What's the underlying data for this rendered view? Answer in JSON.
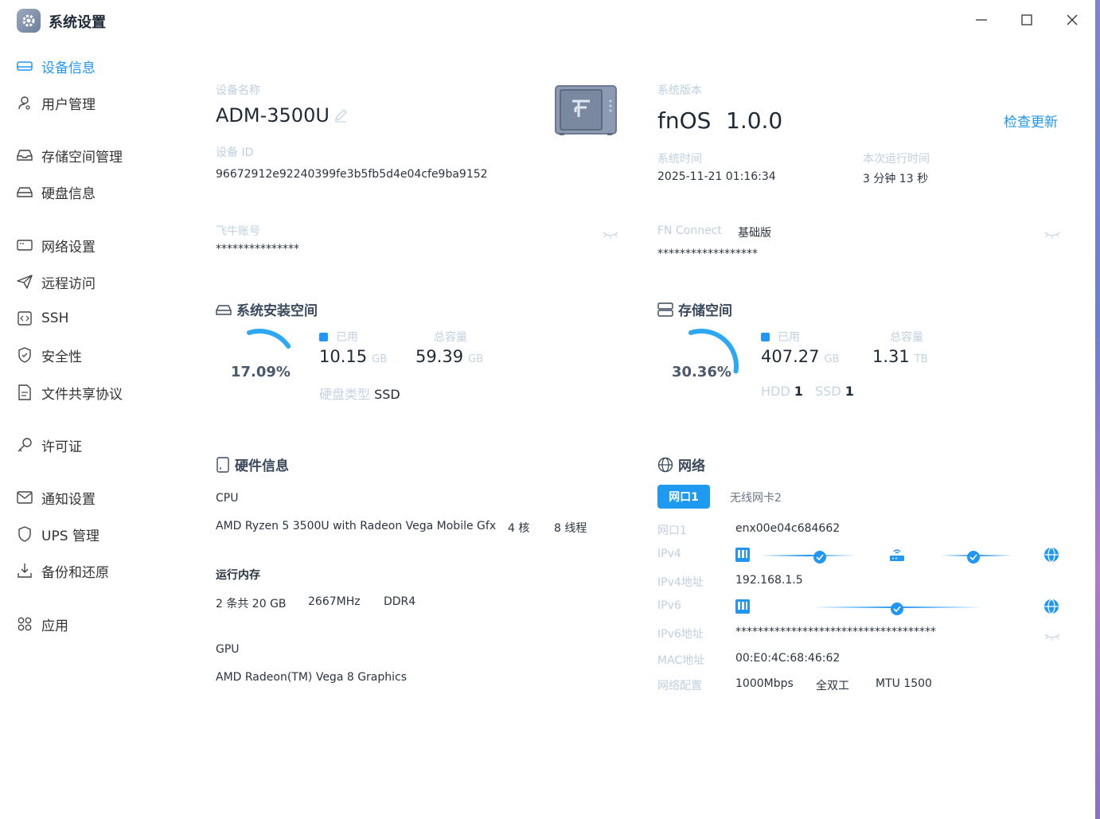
{
  "window": {
    "title": "系统设置",
    "icon": "gear-icon"
  },
  "sidebar": {
    "items": [
      {
        "label": "设备信息",
        "icon": "monitor-icon",
        "active": true
      },
      {
        "label": "用户管理",
        "icon": "user-icon"
      },
      {
        "label": "存储空间管理",
        "icon": "inbox-icon"
      },
      {
        "label": "硬盘信息",
        "icon": "drive-icon"
      },
      {
        "label": "网络设置",
        "icon": "network-icon"
      },
      {
        "label": "远程访问",
        "icon": "send-icon"
      },
      {
        "label": "SSH",
        "icon": "code-icon"
      },
      {
        "label": "安全性",
        "icon": "shield-icon"
      },
      {
        "label": "文件共享协议",
        "icon": "file-icon"
      },
      {
        "label": "许可证",
        "icon": "key-icon"
      },
      {
        "label": "通知设置",
        "icon": "mail-icon"
      },
      {
        "label": "UPS 管理",
        "icon": "ups-shield-icon"
      },
      {
        "label": "备份和还原",
        "icon": "download-icon"
      },
      {
        "label": "应用",
        "icon": "apps-icon"
      }
    ]
  },
  "device": {
    "name_label": "设备名称",
    "name": "ADM-3500U",
    "id_label": "设备 ID",
    "id": "96672912e92240399fe3b5fb5d4e04cfe9ba9152",
    "account_label": "飞牛账号",
    "account": "***************"
  },
  "system": {
    "version_label": "系统版本",
    "os": "fnOS",
    "version": "1.0.0",
    "check_update": "检查更新",
    "time_label": "系统时间",
    "time": "2025-11-21 01:16:34",
    "uptime_label": "本次运行时间",
    "uptime": "3 分钟 13 秒",
    "fn_connect_label": "FN Connect",
    "fn_connect_plan": "基础版",
    "fn_connect_value": "******************"
  },
  "install_space": {
    "title": "系统安装空间",
    "percent": "17.09%",
    "ratio": 0.1709,
    "used_label": "已用",
    "used": "10.15",
    "used_unit": "GB",
    "total_label": "总容量",
    "total": "59.39",
    "total_unit": "GB",
    "disk_type_label": "硬盘类型",
    "disk_type": "SSD"
  },
  "storage": {
    "title": "存储空间",
    "percent": "30.36%",
    "ratio": 0.3036,
    "used_label": "已用",
    "used": "407.27",
    "used_unit": "GB",
    "total_label": "总容量",
    "total": "1.31",
    "total_unit": "TB",
    "hdd_label": "HDD",
    "hdd": "1",
    "ssd_label": "SSD",
    "ssd": "1"
  },
  "hardware": {
    "title": "硬件信息",
    "cpu_label": "CPU",
    "cpu": "AMD Ryzen 5 3500U with Radeon Vega Mobile Gfx",
    "cores": "4 核",
    "threads": "8 线程",
    "ram_label": "运行内存",
    "ram": "2 条共 20 GB",
    "ram_freq": "2667MHz",
    "ram_type": "DDR4",
    "gpu_label": "GPU",
    "gpu": "AMD Radeon(TM) Vega 8 Graphics"
  },
  "network": {
    "title": "网络",
    "tabs": [
      "网口1",
      "无线网卡2"
    ],
    "port_label": "网口1",
    "port": "enx00e04c684662",
    "ipv4_label": "IPv4",
    "ipv4_addr_label": "IPv4地址",
    "ipv4_addr": "192.168.1.5",
    "ipv6_label": "IPv6",
    "ipv6_addr_label": "IPv6地址",
    "ipv6_addr": "************************************",
    "mac_label": "MAC地址",
    "mac": "00:E0:4C:68:46:62",
    "config_label": "网络配置",
    "speed": "1000Mbps",
    "duplex": "全双工",
    "mtu": "MTU 1500"
  },
  "colors": {
    "accent": "#2196f3",
    "label": "#bfd0e0"
  }
}
